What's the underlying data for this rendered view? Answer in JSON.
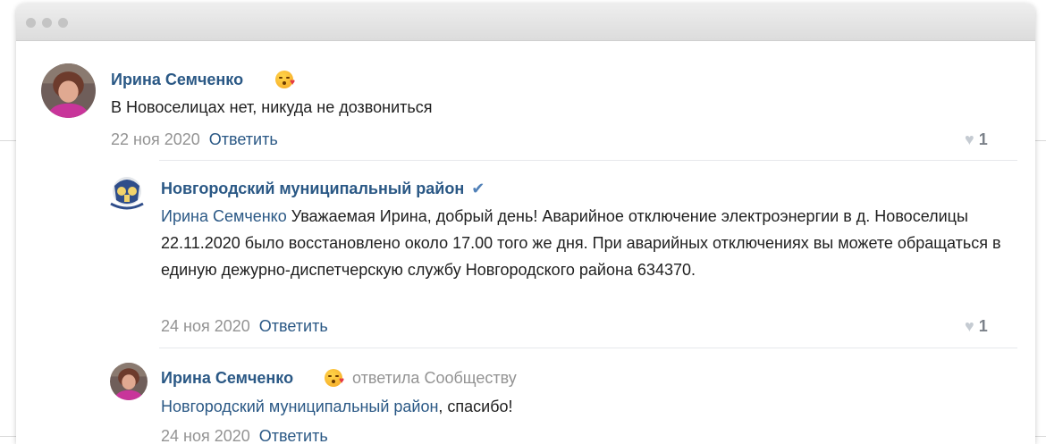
{
  "comments": [
    {
      "author": "Ирина Семченко",
      "text": "В Новоселицах нет, никуда не дозвониться",
      "date": "22 ноя 2020",
      "reply_label": "Ответить",
      "likes": "1"
    },
    {
      "author": "Новгородский муниципальный район",
      "verified_icon": "✔",
      "mention": "Ирина Семченко",
      "text": " Уважаемая Ирина, добрый день! Аварийное отключение электроэнергии в д. Новоселицы 22.11.2020 было восстановлено около 17.00 того же дня. При аварийных отключениях вы можете обращаться в единую дежурно-диспетчерскую службу Новгородского района 634370.",
      "date": "24 ноя 2020",
      "reply_label": "Ответить",
      "likes": "1"
    },
    {
      "author": "Ирина Семченко",
      "replied_to": "ответила Сообществу",
      "mention": "Новгородский муниципальный район",
      "text": ", спасибо!",
      "date": "24 ноя 2020",
      "reply_label": "Ответить"
    }
  ],
  "icons": {
    "like": "heart-icon",
    "emoji": "kissing-face-emoji-icon",
    "verified": "checkmark-icon"
  },
  "colors": {
    "link": "#2a5885",
    "meta": "#939393",
    "verified": "#5181b8"
  }
}
